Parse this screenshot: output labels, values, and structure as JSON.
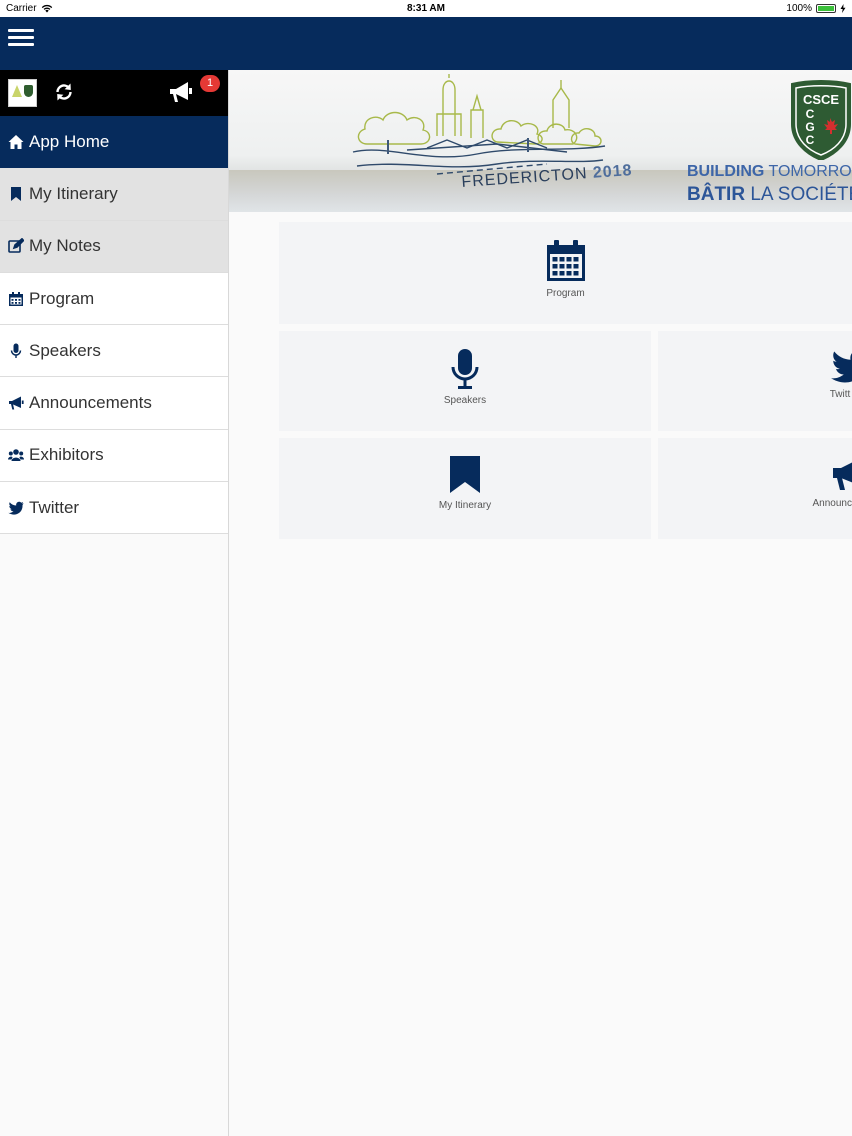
{
  "status_bar": {
    "carrier": "Carrier",
    "time": "8:31 AM",
    "battery": "100%"
  },
  "colors": {
    "navy": "#062b5c",
    "badge": "#e53935",
    "tile_bg": "#f3f4f6"
  },
  "sidebar": {
    "badge_count": "1",
    "items": [
      {
        "label": "App Home",
        "icon": "home-icon"
      },
      {
        "label": "My Itinerary",
        "icon": "bookmark-icon"
      },
      {
        "label": "My Notes",
        "icon": "edit-icon"
      },
      {
        "label": "Program",
        "icon": "calendar-icon"
      },
      {
        "label": "Speakers",
        "icon": "microphone-icon"
      },
      {
        "label": "Announcements",
        "icon": "megaphone-icon"
      },
      {
        "label": "Exhibitors",
        "icon": "users-icon"
      },
      {
        "label": "Twitter",
        "icon": "twitter-icon"
      }
    ]
  },
  "banner": {
    "city_text": "FREDERICTON",
    "year": "2018",
    "shield_text": [
      "CSCE",
      "C",
      "G",
      "C"
    ],
    "tagline1_bold": "BUILDING",
    "tagline1_rest": " TOMORRO",
    "tagline2_bold": "BÂTIR",
    "tagline2_rest": " LA SOCIÉTÉ"
  },
  "tiles": [
    {
      "label": "Program",
      "icon": "calendar-icon"
    },
    {
      "label": "Speakers",
      "icon": "microphone-icon"
    },
    {
      "label": "Twitt",
      "icon": "twitter-icon"
    },
    {
      "label": "My Itinerary",
      "icon": "bookmark-icon"
    },
    {
      "label": "Announce",
      "icon": "megaphone-icon"
    }
  ]
}
